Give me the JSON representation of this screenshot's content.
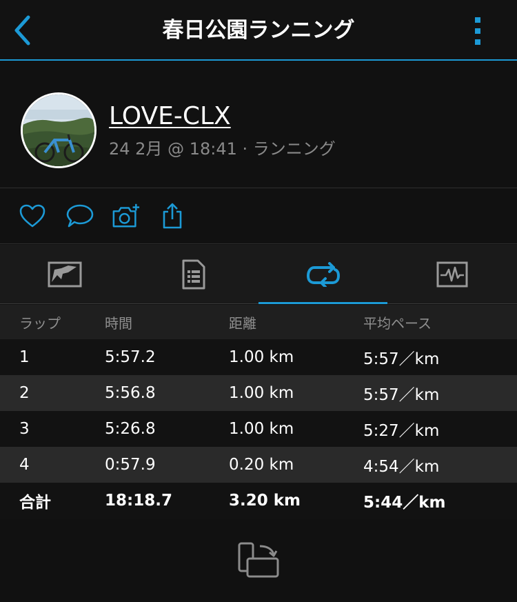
{
  "header": {
    "title": "春日公園ランニング",
    "back_icon": "chevron-left-icon",
    "more_icon": "more-vertical-icon",
    "accent_color": "#1c9ad6"
  },
  "activity": {
    "name": "LOVE-CLX",
    "meta": "24 2月 @ 18:41 · ランニング",
    "avatar": "bicycle-landscape-photo"
  },
  "actions": [
    "heart-icon",
    "comment-icon",
    "add-photo-icon",
    "share-icon"
  ],
  "tabs": [
    {
      "icon": "map-icon",
      "active": false
    },
    {
      "icon": "details-list-icon",
      "active": false
    },
    {
      "icon": "laps-loop-icon",
      "active": true
    },
    {
      "icon": "chart-icon",
      "active": false
    }
  ],
  "laps": {
    "headers": [
      "ラップ",
      "時間",
      "距離",
      "平均ペース"
    ],
    "rows": [
      [
        "1",
        "5:57.2",
        "1.00 km",
        "5:57／km"
      ],
      [
        "2",
        "5:56.8",
        "1.00 km",
        "5:57／km"
      ],
      [
        "3",
        "5:26.8",
        "1.00 km",
        "5:27／km"
      ],
      [
        "4",
        "0:57.9",
        "0.20 km",
        "4:54／km"
      ]
    ],
    "total": [
      "合計",
      "18:18.7",
      "3.20 km",
      "5:44／km"
    ]
  },
  "footer": {
    "rotate_icon": "rotate-screen-icon"
  }
}
